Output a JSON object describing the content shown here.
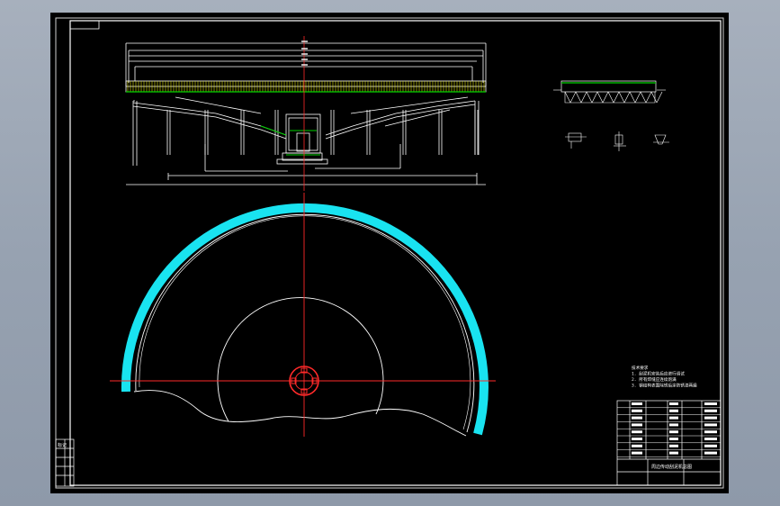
{
  "window": {
    "app": "CAD drawing viewer",
    "background_color": "#000000",
    "frame_color": "#c8c8c8"
  },
  "colors": {
    "line_white": "#ffffff",
    "centerline_red": "#ff2a2a",
    "hatch_cyan": "#19e3f0",
    "accent_green": "#00d200",
    "accent_yellow": "#e8e800"
  },
  "title_block": {
    "note_lines": [
      "技术要求",
      "1. 刮泥机安装后应进行调试",
      "2. 所有焊缝应连续饱满",
      "3. 钢结构表面除锈后涂防锈漆两遍"
    ],
    "rows": 8,
    "drawing_title": "周边传动刮泥机总图"
  },
  "revision_block": {
    "label": "标记"
  },
  "icons": {
    "center_drive": "drive-hub-icon",
    "detail_a": "detail-view-icon"
  }
}
